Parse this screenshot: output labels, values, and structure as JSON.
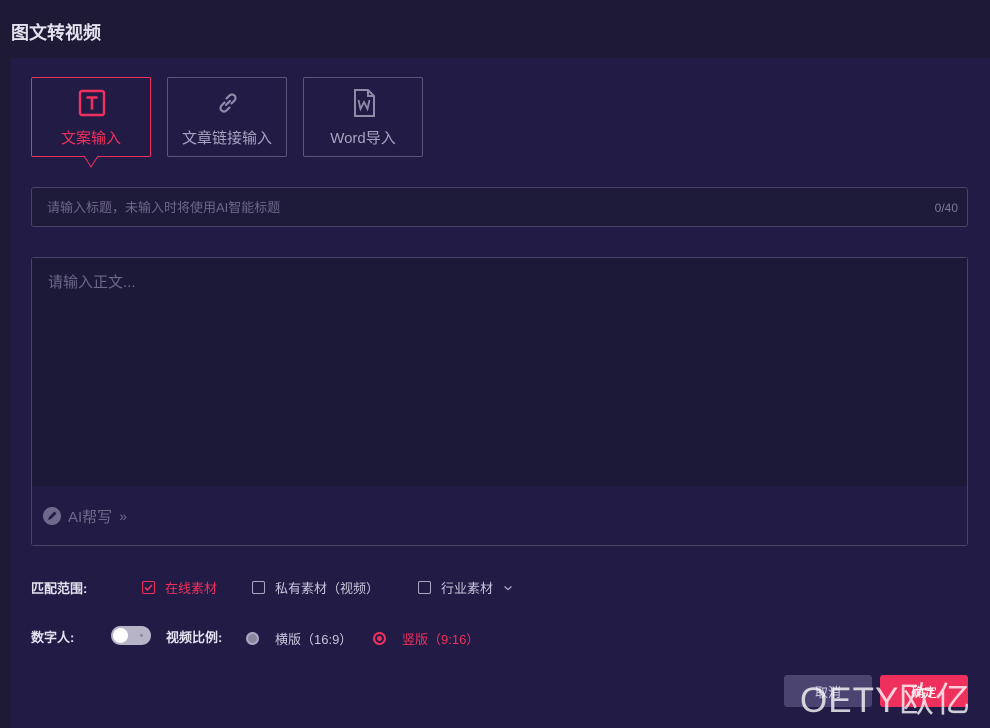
{
  "header": {
    "title": "图文转视频"
  },
  "tabs": [
    {
      "label": "文案输入",
      "icon": "text-icon",
      "active": true
    },
    {
      "label": "文章链接输入",
      "icon": "link-icon",
      "active": false
    },
    {
      "label": "Word导入",
      "icon": "word-file-icon",
      "active": false
    }
  ],
  "title_input": {
    "placeholder": "请输入标题，未输入时将使用AI智能标题",
    "value": "",
    "counter": "0/40"
  },
  "body_input": {
    "placeholder": "请输入正文...",
    "value": ""
  },
  "ai_help": {
    "label": "AI帮写",
    "chevron": "»"
  },
  "match_scope": {
    "label": "匹配范围:",
    "options": [
      {
        "label": "在线素材",
        "checked": true
      },
      {
        "label": "私有素材（视频）",
        "checked": false
      },
      {
        "label": "行业素材",
        "checked": false
      }
    ]
  },
  "digital_human": {
    "label": "数字人:",
    "enabled": false
  },
  "video_ratio": {
    "label": "视频比例:",
    "options": [
      {
        "label": "横版（16:9）",
        "selected": false
      },
      {
        "label": "竖版（9:16）",
        "selected": true
      }
    ]
  },
  "actions": {
    "cancel_label": "取消",
    "confirm_label": "确定"
  },
  "watermark": "OETY欧亿",
  "colors": {
    "accent": "#f0305c",
    "background": "#1e1a36",
    "panel": "#221b45"
  }
}
